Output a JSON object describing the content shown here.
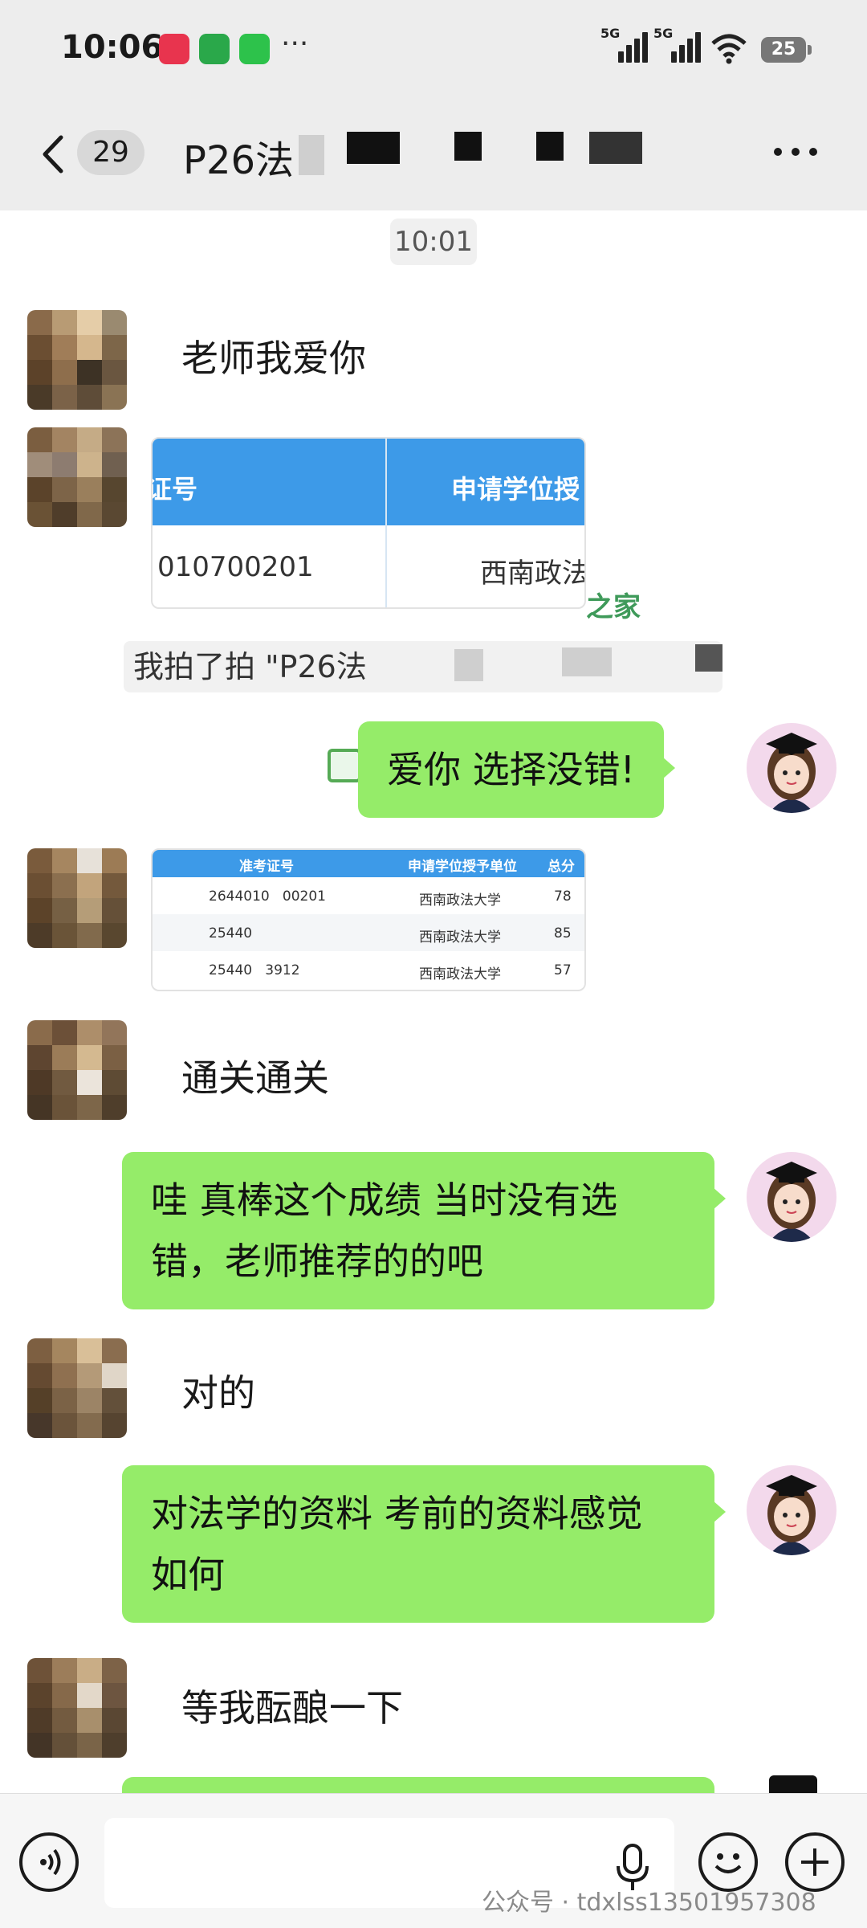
{
  "status_bar": {
    "time": "10:06",
    "dots": "···",
    "network_1": "5G",
    "network_2": "5G",
    "battery": "25"
  },
  "header": {
    "unread_count": "29",
    "title": "P26法"
  },
  "timestamp": "10:01",
  "messages": [
    {
      "side": "left",
      "type": "text",
      "text": "老师我爱你"
    },
    {
      "side": "left",
      "type": "image",
      "header_cols": [
        "考证号",
        "申请学位授"
      ],
      "row": [
        "010700201",
        "西南政法"
      ],
      "watermark": "之家"
    },
    {
      "type": "pat",
      "text": "我拍了拍 \"P26法"
    },
    {
      "side": "right",
      "type": "text",
      "text": "爱你 选择没错!"
    },
    {
      "side": "left",
      "type": "image",
      "header_cols": [
        "准考证号",
        "申请学位授予单位",
        "总分"
      ],
      "rows": [
        [
          "2644010   00201",
          "西南政法大学",
          "78"
        ],
        [
          "25440",
          "西南政法大学",
          "85"
        ],
        [
          "25440   3912",
          "西南政法大学",
          "57"
        ]
      ]
    },
    {
      "side": "left",
      "type": "text",
      "text": "通关通关"
    },
    {
      "side": "right",
      "type": "text",
      "line1": "哇 真棒这个成绩 当时没有选",
      "line2": "错，老师推荐的的吧"
    },
    {
      "side": "left",
      "type": "text",
      "text": "对的"
    },
    {
      "side": "right",
      "type": "text",
      "line1": "对法学的资料  考前的资料感觉",
      "line2": "如何"
    },
    {
      "side": "left",
      "type": "text",
      "text": "等我酝酿一下"
    }
  ],
  "input": {
    "placeholder": ""
  },
  "footer_watermark": "公众号 · tdxlss13501957308",
  "colors": {
    "bubble_green": "#95ec69",
    "table_header_blue": "#3d9ae8",
    "background": "#ededed"
  },
  "icons": [
    "back-icon",
    "more-icon",
    "voice-icon",
    "mic-icon",
    "emoji-icon",
    "plus-icon",
    "check-icon"
  ]
}
